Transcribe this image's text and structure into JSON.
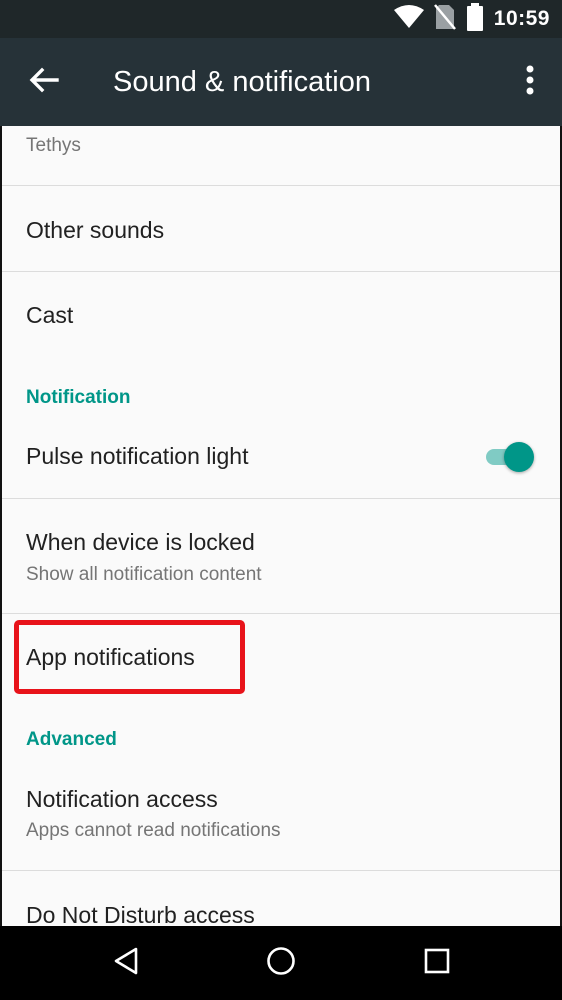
{
  "status_bar": {
    "time": "10:59",
    "battery_level": "96"
  },
  "app_bar": {
    "title": "Sound & notification"
  },
  "list": {
    "partial_item": {
      "summary": "Tethys"
    },
    "other_sounds": {
      "title": "Other sounds"
    },
    "cast": {
      "title": "Cast"
    },
    "notification_header": "Notification",
    "pulse_light": {
      "title": "Pulse notification light",
      "enabled": true
    },
    "device_locked": {
      "title": "When device is locked",
      "summary": "Show all notification content"
    },
    "app_notifications": {
      "title": "App notifications"
    },
    "advanced_header": "Advanced",
    "notification_access": {
      "title": "Notification access",
      "summary": "Apps cannot read notifications"
    },
    "dnd_access": {
      "title": "Do Not Disturb access"
    }
  },
  "colors": {
    "accent": "#009688",
    "app_bar": "#263238",
    "status_bar": "#1f2729",
    "highlight": "#e8131a"
  }
}
